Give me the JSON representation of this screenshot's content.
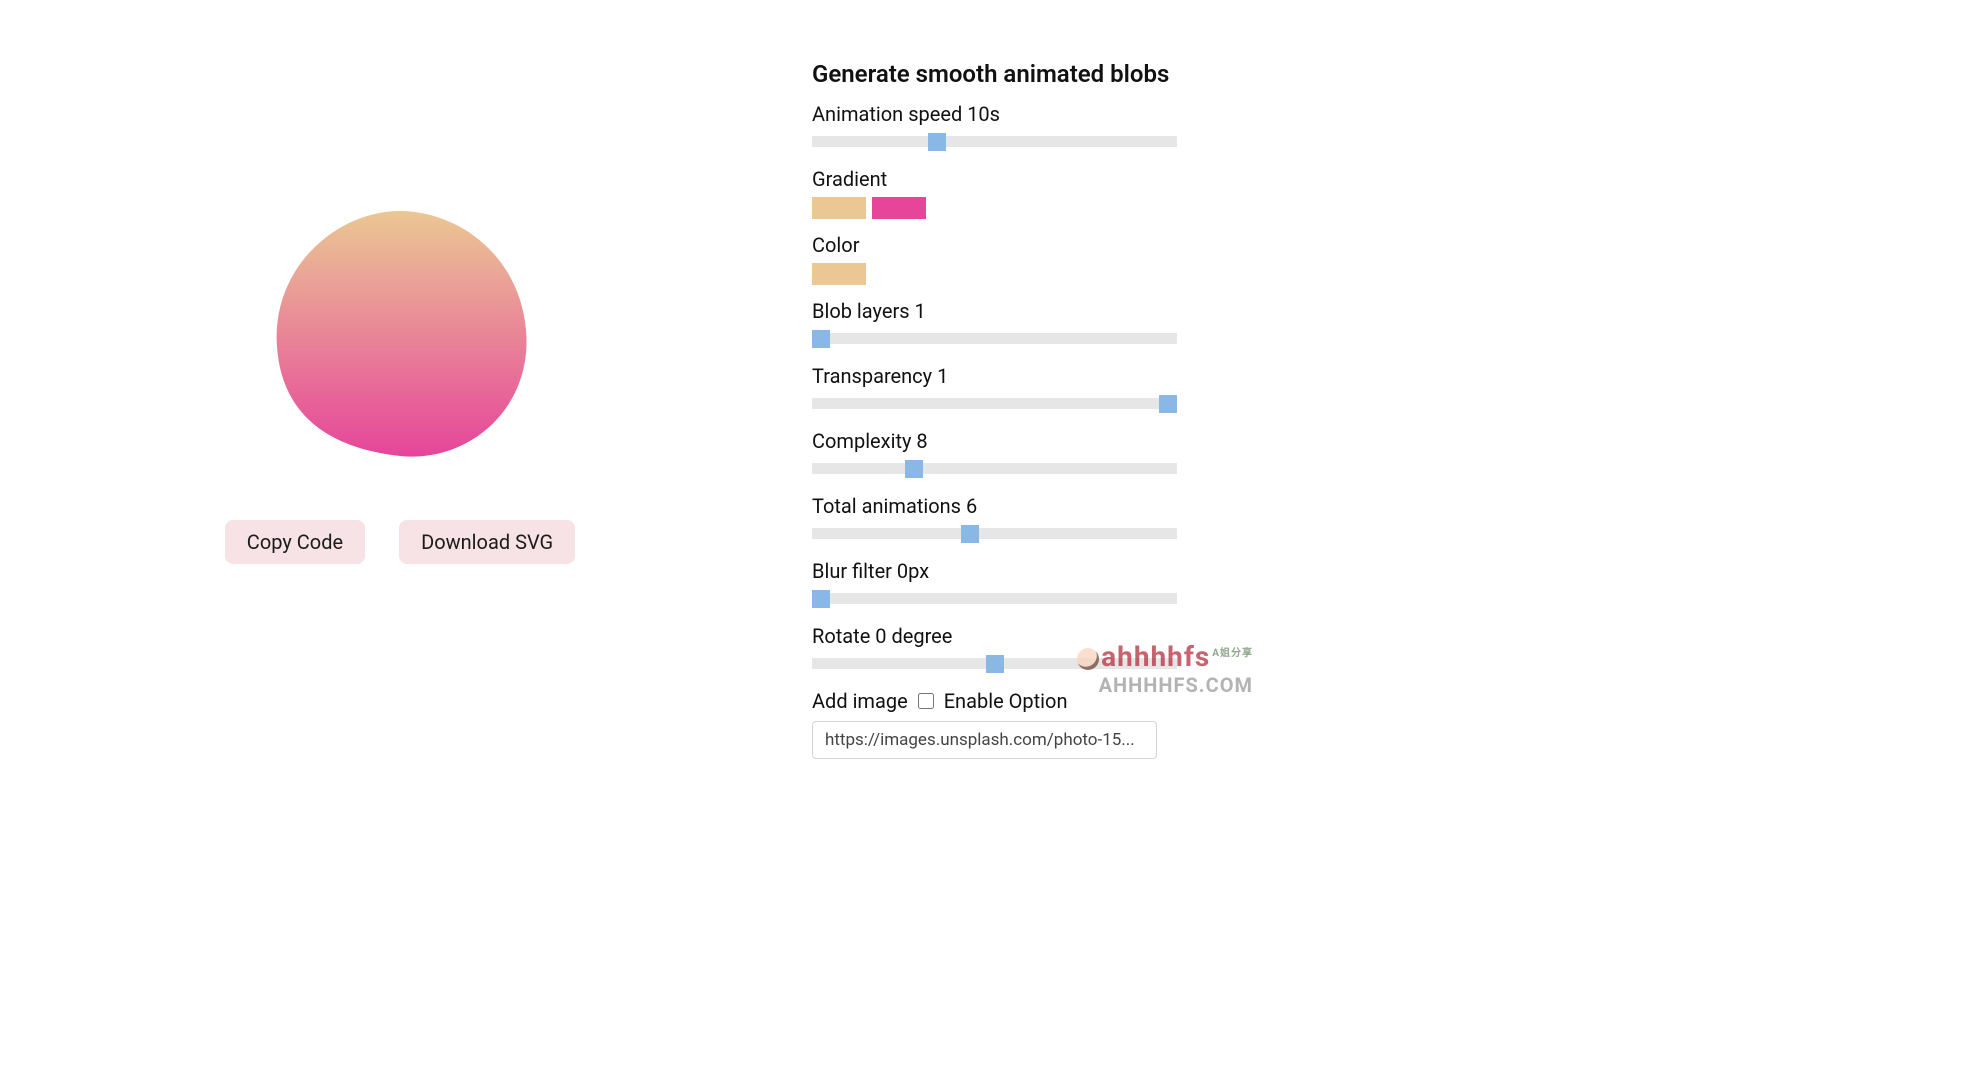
{
  "title": "Generate smooth animated blobs",
  "buttons": {
    "copy_code": "Copy Code",
    "download_svg": "Download SVG"
  },
  "colors": {
    "gradient_start": "#ebc794",
    "gradient_end": "#e6459a",
    "color_single": "#ebc794",
    "slider_track": "#e6e6e6",
    "slider_thumb": "#8ab8e6",
    "button_bg": "#f7e2e6"
  },
  "controls": {
    "animation_speed": {
      "label": "Animation speed 10s",
      "value": 10,
      "min": 0,
      "max": 30
    },
    "gradient": {
      "label": "Gradient"
    },
    "color": {
      "label": "Color"
    },
    "blob_layers": {
      "label": "Blob layers 1",
      "value": 1,
      "min": 1,
      "max": 20
    },
    "transparency": {
      "label": "Transparency 1",
      "value": 1,
      "min": 0,
      "max": 1
    },
    "complexity": {
      "label": "Complexity 8",
      "value": 8,
      "min": 0,
      "max": 30
    },
    "total_animations": {
      "label": "Total animations 6",
      "value": 6,
      "min": 0,
      "max": 14
    },
    "blur_filter": {
      "label": "Blur filter 0px",
      "value": 0,
      "min": 0,
      "max": 50
    },
    "rotate": {
      "label": "Rotate 0 degree",
      "value": 0,
      "min": -180,
      "max": 180
    },
    "add_image": {
      "label": "Add image",
      "checkbox_label": "Enable Option",
      "checked": false,
      "value": "https://images.unsplash.com/photo-15..."
    }
  },
  "watermark": {
    "line1": "ahhhhfs",
    "tiny": "A姐分享",
    "line2": "AHHHHFS.COM"
  }
}
